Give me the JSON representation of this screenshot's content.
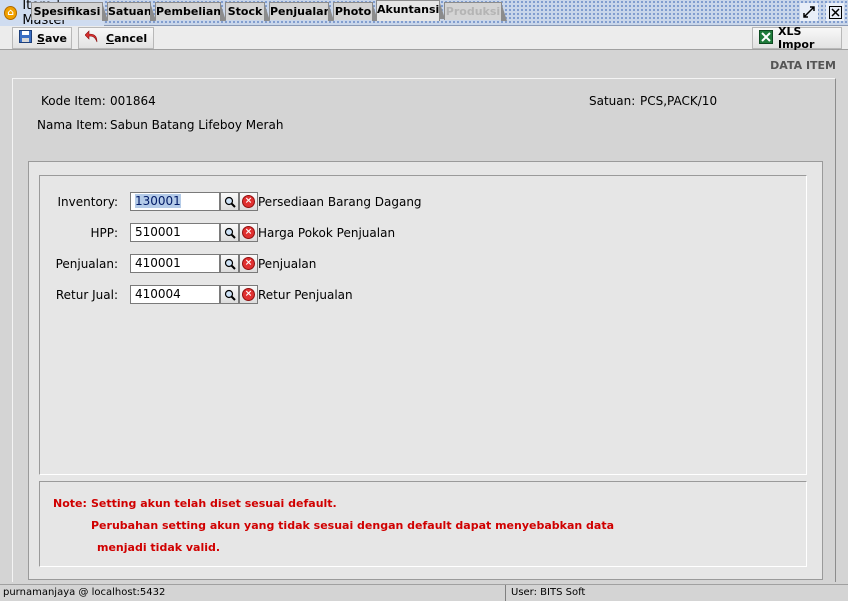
{
  "window": {
    "title": "Item | Master"
  },
  "toolbar": {
    "save_label": "ave",
    "save_mnemonic": "S",
    "cancel_label": "ancel",
    "cancel_mnemonic": "C",
    "xls_label": "XLS Impor"
  },
  "header": {
    "section_title": "DATA ITEM"
  },
  "item": {
    "kode_label": "Kode Item:",
    "kode_value": "001864",
    "nama_label": "Nama Item:",
    "nama_value": "Sabun Batang Lifeboy Merah",
    "satuan_label": "Satuan:",
    "satuan_value": "PCS,PACK/10"
  },
  "tabs": [
    {
      "label": "Spesifikasi",
      "state": "normal"
    },
    {
      "label": "Satuan",
      "state": "normal"
    },
    {
      "label": "Pembelian",
      "state": "normal"
    },
    {
      "label": "Stock",
      "state": "normal"
    },
    {
      "label": "Penjualan",
      "state": "normal"
    },
    {
      "label": "Photo",
      "state": "normal"
    },
    {
      "label": "Akuntansi",
      "state": "active"
    },
    {
      "label": "Produksi",
      "state": "disabled"
    }
  ],
  "akuntansi": {
    "rows": [
      {
        "label": "Inventory:",
        "code": "130001",
        "name": "Persediaan Barang Dagang"
      },
      {
        "label": "HPP:",
        "code": "510001",
        "name": "Harga Pokok Penjualan"
      },
      {
        "label": "Penjualan:",
        "code": "410001",
        "name": "Penjualan"
      },
      {
        "label": "Retur Jual:",
        "code": "410004",
        "name": "Retur Penjualan"
      }
    ]
  },
  "note": {
    "prefix": "Note:",
    "line1": "Setting akun telah diset sesuai default.",
    "line2": "Perubahan setting akun yang tidak sesuai dengan default dapat menyebabkan data",
    "line3": "menjadi tidak valid."
  },
  "status": {
    "connection": "purnamanjaya @ localhost:5432",
    "user": "User: BITS Soft"
  },
  "colors": {
    "note_text": "#d00000",
    "titlebar_pattern": "#6f8fc8"
  },
  "icons": {
    "title": "app-logo-icon",
    "save": "floppy-disk-icon",
    "cancel": "undo-arrow-icon",
    "xls": "excel-icon",
    "lookup": "magnifier-icon",
    "clear": "clear-x-icon"
  }
}
